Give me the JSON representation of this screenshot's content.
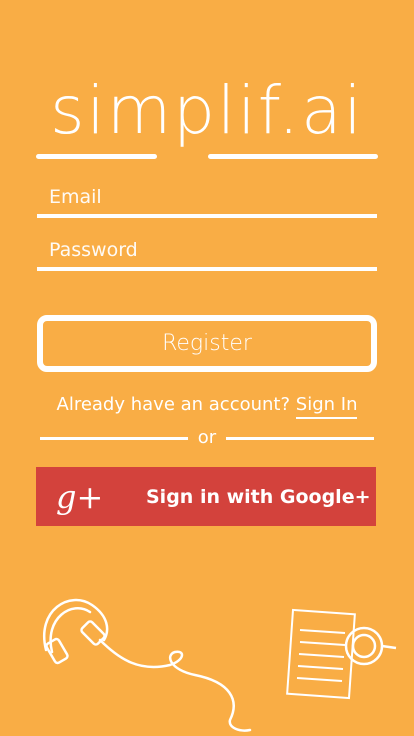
{
  "brand": {
    "logo_text": "simplif.ai"
  },
  "form": {
    "email_placeholder": "Email",
    "password_placeholder": "Password",
    "register_label": "Register"
  },
  "signin_prompt": {
    "text": "Already have an account?",
    "link_label": "Sign In"
  },
  "divider": {
    "label": "or"
  },
  "google": {
    "icon": "google-plus-icon",
    "icon_text": "g+",
    "label": "Sign in with Google+"
  },
  "decorations": [
    "headphones-icon",
    "notebook-icon",
    "coffee-cup-icon"
  ],
  "colors": {
    "background": "#f9ad45",
    "google_red": "#d3423c",
    "foreground": "#ffffff"
  }
}
